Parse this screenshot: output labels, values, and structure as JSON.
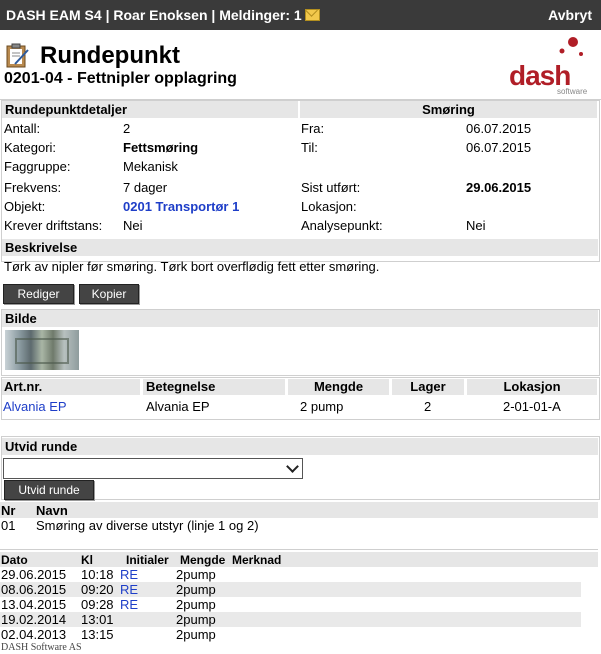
{
  "topbar": {
    "title": "DASH EAM S4 | Roar Enoksen | Meldinger: 1",
    "cancel": "Avbryt"
  },
  "header": {
    "title": "Rundepunkt",
    "subtitle": "0201-04 - Fettnipler opplagring",
    "logo_text": "dash",
    "logo_sub": "software"
  },
  "details": {
    "section_title": "Rundepunktdetaljer",
    "right_title": "Smøring",
    "rows": [
      {
        "l1": "Antall:",
        "v1": "2",
        "l2": "Fra:",
        "v2": "06.07.2015"
      },
      {
        "l1": "Kategori:",
        "v1": "Fettsmøring",
        "l2": "Til:",
        "v2": "06.07.2015"
      },
      {
        "l1": "Faggruppe:",
        "v1": "Mekanisk",
        "l2": "",
        "v2": ""
      },
      {
        "l1": "Frekvens:",
        "v1": "7 dager",
        "l2": "Sist utført:",
        "v2": "29.06.2015"
      },
      {
        "l1": "Objekt:",
        "v1": "0201 Transportør 1",
        "l2": "Lokasjon:",
        "v2": ""
      },
      {
        "l1": "Krever driftstans:",
        "v1": "Nei",
        "l2": "Analysepunkt:",
        "v2": "Nei"
      }
    ]
  },
  "description": {
    "title": "Beskrivelse",
    "text": "Tørk av nipler før smøring. Tørk bort overflødig fett etter smøring."
  },
  "buttons": {
    "edit": "Rediger",
    "copy": "Kopier",
    "expand": "Utvid runde"
  },
  "image_section": {
    "title": "Bilde"
  },
  "parts": {
    "headers": [
      "Art.nr.",
      "Betegnelse",
      "Mengde",
      "Lager",
      "Lokasjon"
    ],
    "rows": [
      [
        "Alvania EP",
        "Alvania EP",
        "2 pump",
        "2",
        "2-01-01-A"
      ]
    ]
  },
  "expand": {
    "title": "Utvid runde",
    "select_value": ""
  },
  "round": {
    "headers": [
      "Nr",
      "Navn"
    ],
    "rows": [
      [
        "01",
        "Smøring av diverse utstyr (linje 1 og 2)"
      ]
    ]
  },
  "history": {
    "headers": [
      "Dato",
      "Kl",
      "Initialer",
      "Mengde",
      "Merknad"
    ],
    "rows": [
      [
        "29.06.2015",
        "10:18",
        "RE",
        "2pump",
        ""
      ],
      [
        "08.06.2015",
        "09:20",
        "RE",
        "2pump",
        ""
      ],
      [
        "13.04.2015",
        "09:28",
        "RE",
        "2pump",
        ""
      ],
      [
        "19.02.2014",
        "13:01",
        "",
        "2pump",
        ""
      ],
      [
        "02.04.2013",
        "13:15",
        "",
        "2pump",
        ""
      ]
    ]
  },
  "footer": "DASH Software AS",
  "colors": {
    "topbar": "#3a3a3a",
    "section": "#e6e6e6",
    "link": "#1e3ec8",
    "brand": "#b01e27"
  }
}
